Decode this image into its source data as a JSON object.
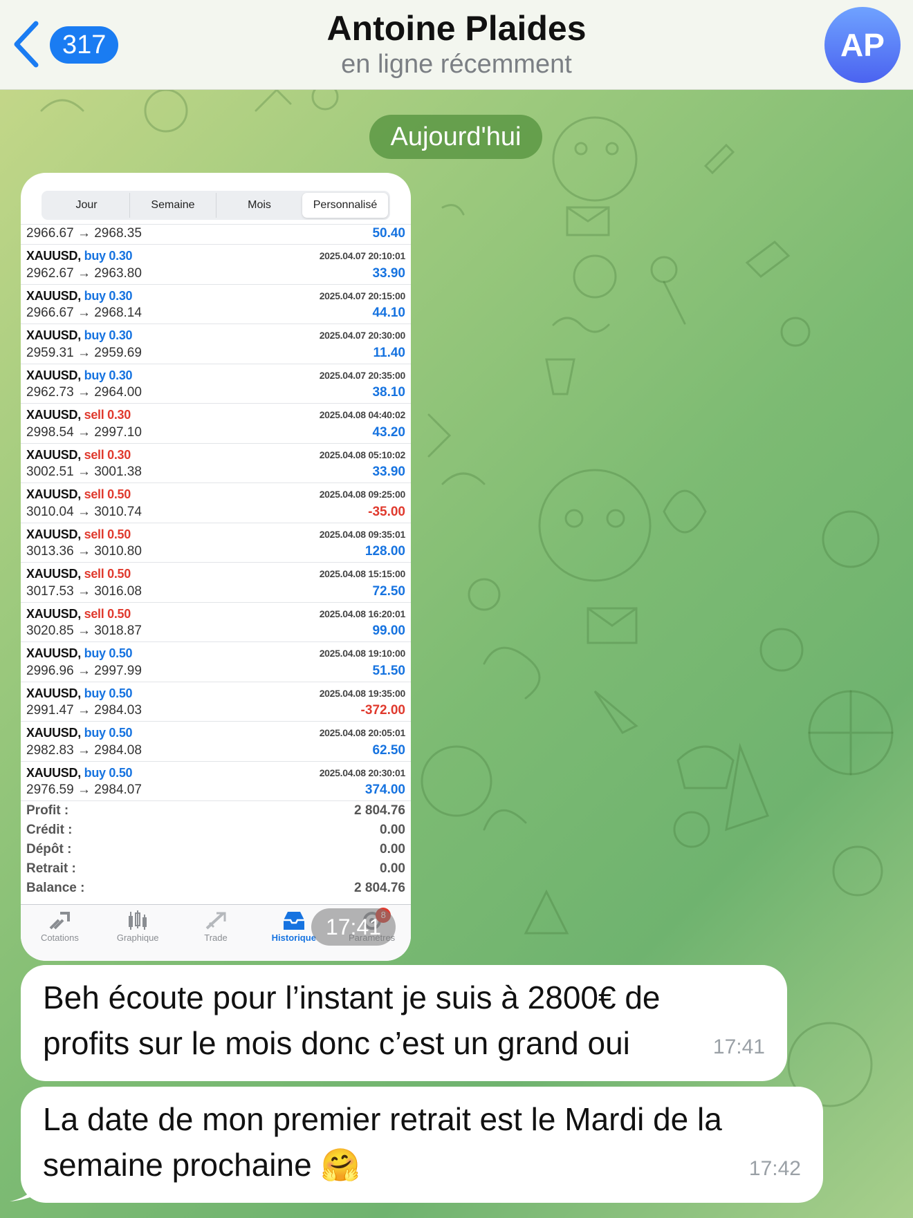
{
  "header": {
    "back_count": "317",
    "contact_name": "Antoine Plaides",
    "status": "en ligne récemment",
    "avatar_initials": "AP"
  },
  "date_separator": "Aujourd'hui",
  "screenshot": {
    "segments": [
      {
        "label": "Jour",
        "active": false
      },
      {
        "label": "Semaine",
        "active": false
      },
      {
        "label": "Mois",
        "active": false
      },
      {
        "label": "Personnalisé",
        "active": true
      }
    ],
    "first_row": {
      "prices": "2966.67 → 2968.35",
      "profit": "50.40"
    },
    "deals": [
      {
        "symbol": "XAUUSD,",
        "side": "buy 0.30",
        "type": "buy",
        "datetime": "2025.04.07 20:10:01",
        "prices": "2962.67 → 2963.80",
        "profit": "33.90",
        "negative": false
      },
      {
        "symbol": "XAUUSD,",
        "side": "buy 0.30",
        "type": "buy",
        "datetime": "2025.04.07 20:15:00",
        "prices": "2966.67 → 2968.14",
        "profit": "44.10",
        "negative": false
      },
      {
        "symbol": "XAUUSD,",
        "side": "buy 0.30",
        "type": "buy",
        "datetime": "2025.04.07 20:30:00",
        "prices": "2959.31 → 2959.69",
        "profit": "11.40",
        "negative": false
      },
      {
        "symbol": "XAUUSD,",
        "side": "buy 0.30",
        "type": "buy",
        "datetime": "2025.04.07 20:35:00",
        "prices": "2962.73 → 2964.00",
        "profit": "38.10",
        "negative": false
      },
      {
        "symbol": "XAUUSD,",
        "side": "sell 0.30",
        "type": "sell",
        "datetime": "2025.04.08 04:40:02",
        "prices": "2998.54 → 2997.10",
        "profit": "43.20",
        "negative": false
      },
      {
        "symbol": "XAUUSD,",
        "side": "sell 0.30",
        "type": "sell",
        "datetime": "2025.04.08 05:10:02",
        "prices": "3002.51 → 3001.38",
        "profit": "33.90",
        "negative": false
      },
      {
        "symbol": "XAUUSD,",
        "side": "sell 0.50",
        "type": "sell",
        "datetime": "2025.04.08 09:25:00",
        "prices": "3010.04 → 3010.74",
        "profit": "-35.00",
        "negative": true
      },
      {
        "symbol": "XAUUSD,",
        "side": "sell 0.50",
        "type": "sell",
        "datetime": "2025.04.08 09:35:01",
        "prices": "3013.36 → 3010.80",
        "profit": "128.00",
        "negative": false
      },
      {
        "symbol": "XAUUSD,",
        "side": "sell 0.50",
        "type": "sell",
        "datetime": "2025.04.08 15:15:00",
        "prices": "3017.53 → 3016.08",
        "profit": "72.50",
        "negative": false
      },
      {
        "symbol": "XAUUSD,",
        "side": "sell 0.50",
        "type": "sell",
        "datetime": "2025.04.08 16:20:01",
        "prices": "3020.85 → 3018.87",
        "profit": "99.00",
        "negative": false
      },
      {
        "symbol": "XAUUSD,",
        "side": "buy 0.50",
        "type": "buy",
        "datetime": "2025.04.08 19:10:00",
        "prices": "2996.96 → 2997.99",
        "profit": "51.50",
        "negative": false
      },
      {
        "symbol": "XAUUSD,",
        "side": "buy 0.50",
        "type": "buy",
        "datetime": "2025.04.08 19:35:00",
        "prices": "2991.47 → 2984.03",
        "profit": "-372.00",
        "negative": true
      },
      {
        "symbol": "XAUUSD,",
        "side": "buy 0.50",
        "type": "buy",
        "datetime": "2025.04.08 20:05:01",
        "prices": "2982.83 → 2984.08",
        "profit": "62.50",
        "negative": false
      },
      {
        "symbol": "XAUUSD,",
        "side": "buy 0.50",
        "type": "buy",
        "datetime": "2025.04.08 20:30:01",
        "prices": "2976.59 → 2984.07",
        "profit": "374.00",
        "negative": false
      }
    ],
    "summary": [
      {
        "label": "Profit :",
        "value": "2 804.76"
      },
      {
        "label": "Crédit :",
        "value": "0.00"
      },
      {
        "label": "Dépôt :",
        "value": "0.00"
      },
      {
        "label": "Retrait :",
        "value": "0.00"
      },
      {
        "label": "Balance :",
        "value": "2 804.76"
      }
    ],
    "tabs": [
      {
        "label": "Cotations",
        "icon": "quotes-icon",
        "active": false
      },
      {
        "label": "Graphique",
        "icon": "chart-icon",
        "active": false
      },
      {
        "label": "Trade",
        "icon": "trade-icon",
        "active": false
      },
      {
        "label": "Historique",
        "icon": "history-icon",
        "active": true
      },
      {
        "label": "Paramètres",
        "icon": "settings-icon",
        "active": false,
        "badge": "8"
      }
    ],
    "time": "17:41"
  },
  "messages": [
    {
      "text_lines": [
        "Beh écoute pour l’instant je suis à 2800€ de",
        "profits sur le mois donc c’est un grand oui"
      ],
      "time": "17:41"
    },
    {
      "text_lines": [
        "La date de mon premier retrait est le Mardi de la",
        "semaine prochaine 🤗"
      ],
      "time": "17:42"
    }
  ],
  "colors": {
    "accent": "#1a7cf2",
    "buy": "#1673e0",
    "sell": "#e03a2e",
    "date_pill": "#5c9844"
  }
}
